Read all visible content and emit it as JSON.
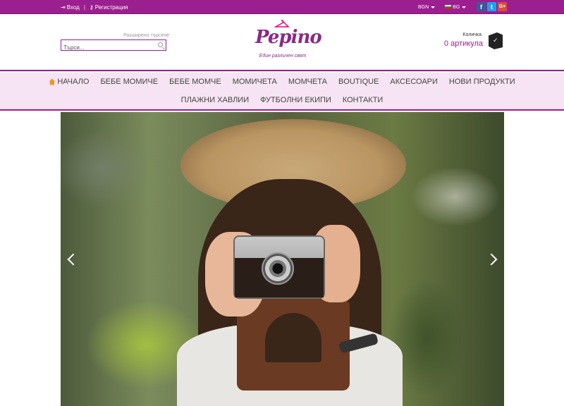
{
  "topbar": {
    "login_label": "Вход",
    "register_label": "Регистрация",
    "currency": "BGN",
    "language": "BG",
    "social": {
      "facebook": "f",
      "twitter": "t",
      "googleplus": "G+"
    }
  },
  "header": {
    "advanced_search_link": "Разширено търсене",
    "search_placeholder": "Търси...",
    "logo_text": "Pepino",
    "logo_tagline": "Един различен свят",
    "cart_label": "Количка",
    "cart_count": "0 артикула"
  },
  "nav": {
    "row1": [
      "НАЧАЛО",
      "БЕБЕ МОМИЧЕ",
      "БЕБЕ МОМЧЕ",
      "МОМИЧЕТА",
      "МОМЧЕТА",
      "BOUTIQUE",
      "АКСЕСОАРИ",
      "НОВИ ПРОДУКТИ"
    ],
    "row2": [
      "ПЛАЖНИ ХАВЛИИ",
      "ФУТБОЛНИ ЕКИПИ",
      "КОНТАКТИ"
    ]
  },
  "colors": {
    "brand": "#9b1f8e",
    "nav_bg": "#f6e3f3",
    "accent_home": "#e89a2c"
  },
  "icons": [
    "login-icon",
    "key-icon",
    "search-icon",
    "home-icon",
    "cart-icon",
    "facebook-icon",
    "twitter-icon",
    "googleplus-icon",
    "chevron-left-icon",
    "chevron-right-icon"
  ]
}
